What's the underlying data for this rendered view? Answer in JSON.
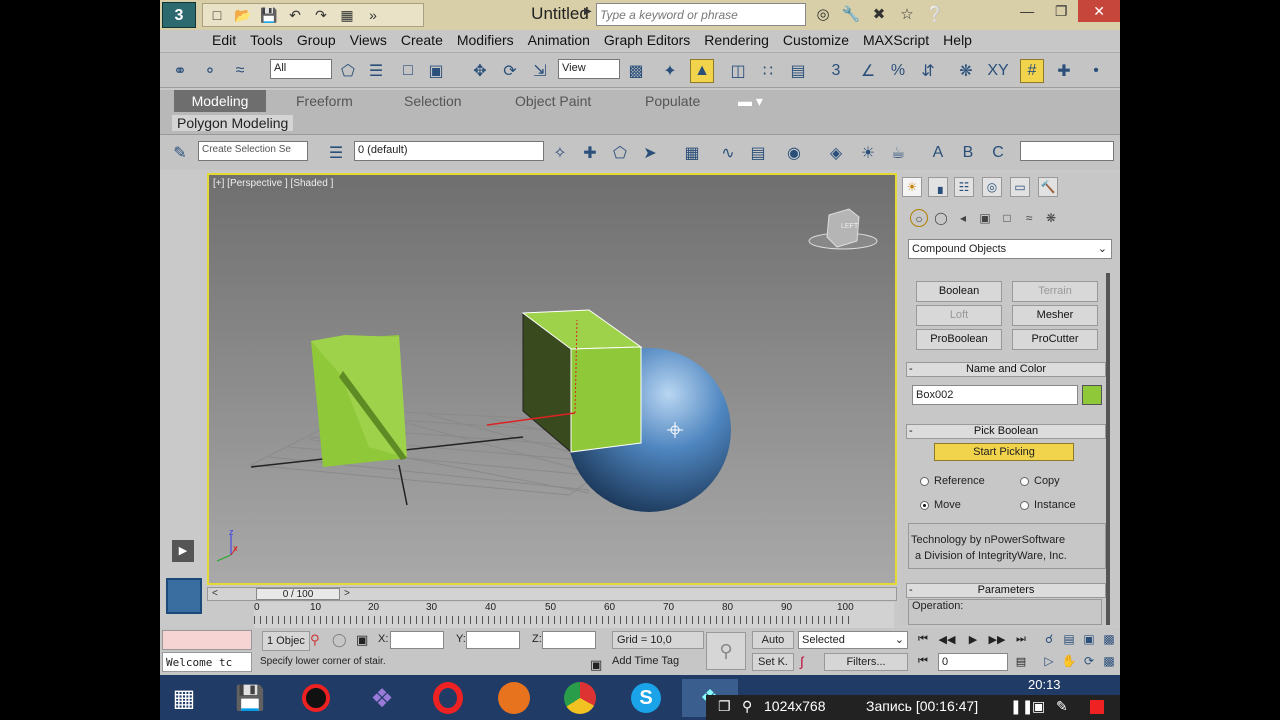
{
  "window": {
    "title": "Untitled",
    "search_placeholder": "Type a keyword or phrase",
    "logo": "3"
  },
  "menu": [
    "Edit",
    "Tools",
    "Group",
    "Views",
    "Create",
    "Modifiers",
    "Animation",
    "Graph Editors",
    "Rendering",
    "Customize",
    "MAXScript",
    "Help"
  ],
  "main_toolbar": {
    "selection_filter": "All",
    "reference_coord": "View"
  },
  "ribbon": {
    "tabs": [
      "Modeling",
      "Freeform",
      "Selection",
      "Object Paint",
      "Populate"
    ],
    "active_tab": "Modeling",
    "subpanel": "Polygon Modeling"
  },
  "layer_toolbar": {
    "named_selection_placeholder": "Create Selection Se",
    "layer_name": "0 (default)"
  },
  "viewport": {
    "label": "[+] [Perspective ] [Shaded ]",
    "viewcube_label": "LEFT",
    "axis_z": "z",
    "axis_x": "x"
  },
  "command_panel": {
    "category": "Compound Objects",
    "buttons": [
      {
        "label": "Boolean",
        "enabled": true
      },
      {
        "label": "Terrain",
        "enabled": false
      },
      {
        "label": "Loft",
        "enabled": false
      },
      {
        "label": "Mesher",
        "enabled": true
      },
      {
        "label": "ProBoolean",
        "enabled": true
      },
      {
        "label": "ProCutter",
        "enabled": true
      }
    ],
    "name_and_color_title": "Name and Color",
    "object_name": "Box002",
    "object_color": "#8fc93a",
    "pick_boolean_title": "Pick Boolean",
    "start_picking": "Start Picking",
    "radio_reference": "Reference",
    "radio_copy": "Copy",
    "radio_move": "Move",
    "radio_instance": "Instance",
    "tech_line1": "Technology by nPowerSoftware",
    "tech_line2": "a Division of IntegrityWare, Inc.",
    "parameters_title": "Parameters",
    "operation_label": "Operation:",
    "rollout_minus": "-"
  },
  "time_slider": {
    "label": "0 / 100",
    "prev": "<",
    "next": ">"
  },
  "trackbar": {
    "ticks": [
      "0",
      "10",
      "20",
      "30",
      "40",
      "50",
      "60",
      "70",
      "80",
      "90",
      "100"
    ]
  },
  "status": {
    "object_count": "1 Objec",
    "maxscript_text": "Welcome tc",
    "prompt": "Specify lower corner of stair.",
    "x_label": "X:",
    "y_label": "Y:",
    "z_label": "Z:",
    "grid": "Grid = 10,0",
    "add_time_tag": "Add Time Tag",
    "auto": "Auto",
    "setk": "Set K.",
    "selected": "Selected",
    "filters": "Filters...",
    "frame": "0"
  },
  "taskbar": {
    "resolution": "1024x768",
    "recording": "Запись [00:16:47]",
    "clock": "20:13"
  },
  "colors": {
    "viewport_border": "#e6d932",
    "box_green": "#8fc93a",
    "sphere_blue": "#4f86c0",
    "start_picking_bg": "#f2d34c"
  }
}
